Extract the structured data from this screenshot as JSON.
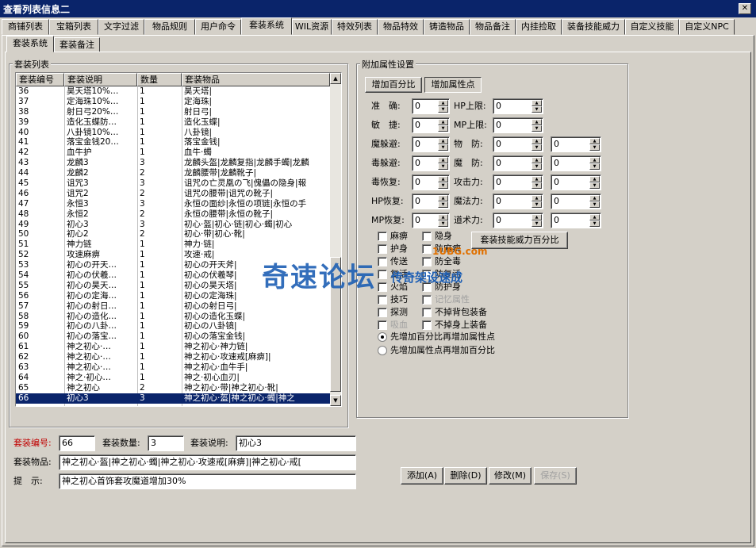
{
  "window": {
    "title": "查看列表信息二",
    "close_label": "✕"
  },
  "tabs": [
    "商铺列表",
    "宝箱列表",
    "文字过滤",
    "物品规则",
    "用户命令",
    "套装系统",
    "WIL资源",
    "特效列表",
    "物品特效",
    "铸造物品",
    "物品备注",
    "内挂捡取",
    "装备技能威力",
    "自定义技能",
    "自定义NPC"
  ],
  "active_tab": "套装系统",
  "subtabs": [
    "套装系统",
    "套装备注"
  ],
  "list": {
    "group_title": "套装列表",
    "columns": [
      "套装编号",
      "套装说明",
      "数量",
      "套装物品"
    ],
    "rows": [
      [
        "36",
        "昊天塔10%…",
        "1",
        "昊天塔|"
      ],
      [
        "37",
        "定海珠10%…",
        "1",
        "定海珠|"
      ],
      [
        "38",
        "射日弓20%…",
        "1",
        "射日弓|"
      ],
      [
        "39",
        "造化玉蝶防…",
        "1",
        "造化玉蝶|"
      ],
      [
        "40",
        "八卦镜10%…",
        "1",
        "八卦镜|"
      ],
      [
        "41",
        "落宝金钱20…",
        "1",
        "落宝金钱|"
      ],
      [
        "42",
        "血牛护",
        "1",
        "血牛·蠋"
      ],
      [
        "43",
        "龙麟3",
        "3",
        "龙麟头盔|龙麟复指|龙麟手蠋|龙麟"
      ],
      [
        "44",
        "龙麟2",
        "2",
        "龙麟腰带|龙麟靴子|"
      ],
      [
        "45",
        "诅咒3",
        "3",
        "诅咒の亡灵凰の飞|傀儡の隐身|報"
      ],
      [
        "46",
        "诅咒2",
        "2",
        "诅咒の腰带|诅咒の靴子|"
      ],
      [
        "47",
        "永恒3",
        "3",
        "永恒の面纱|永恒の项链|永恒の手"
      ],
      [
        "48",
        "永恒2",
        "2",
        "永恒の腰带|永恒の靴子|"
      ],
      [
        "49",
        "初心3",
        "3",
        "初心·盔|初心·链|初心·蠋|初心"
      ],
      [
        "50",
        "初心2",
        "2",
        "初心·带|初心·靴|"
      ],
      [
        "51",
        "神力链",
        "1",
        "神力·链|"
      ],
      [
        "52",
        "攻速麻痹",
        "1",
        "攻速·戒|"
      ],
      [
        "53",
        "初心の开天…",
        "1",
        "初心の开天斧|"
      ],
      [
        "54",
        "初心の伏羲…",
        "1",
        "初心の伏羲琴|"
      ],
      [
        "55",
        "初心の昊天…",
        "1",
        "初心の昊天塔|"
      ],
      [
        "56",
        "初心の定海…",
        "1",
        "初心の定海珠|"
      ],
      [
        "57",
        "初心の射日…",
        "1",
        "初心の射日弓|"
      ],
      [
        "58",
        "初心の造化…",
        "1",
        "初心の造化玉蝶|"
      ],
      [
        "59",
        "初心の八卦…",
        "1",
        "初心の八卦镜|"
      ],
      [
        "60",
        "初心の落宝…",
        "1",
        "初心の落宝金钱|"
      ],
      [
        "61",
        "神之初心·…",
        "1",
        "神之初心·神力链|"
      ],
      [
        "62",
        "神之初心·…",
        "1",
        "神之初心·攻速戒[麻痹]|"
      ],
      [
        "63",
        "神之初心·…",
        "1",
        "神之初心·血牛手|"
      ],
      [
        "64",
        "神之·初心…",
        "1",
        "神之·初心血刃|"
      ],
      [
        "65",
        "神之初心",
        "2",
        "神之初心·带|神之初心·靴|"
      ],
      [
        "66",
        "初心3",
        "3",
        "神之初心·盔|神之初心·蠋|神之"
      ]
    ],
    "selected_row": "66"
  },
  "attr": {
    "group_title": "附加属性设置",
    "btn_percent": "增加百分比",
    "btn_points": "增加属性点",
    "fields_left": [
      {
        "label": "准　确:",
        "value": "0"
      },
      {
        "label": "敏　捷:",
        "value": "0"
      },
      {
        "label": "魔躲避:",
        "value": "0"
      },
      {
        "label": "毒躲避:",
        "value": "0"
      },
      {
        "label": "毒恢复:",
        "value": "0"
      },
      {
        "label": "HP恢复:",
        "value": "0"
      },
      {
        "label": "MP恢复:",
        "value": "0"
      }
    ],
    "fields_right": [
      {
        "label": "HP上限:",
        "value": "0",
        "value2": null
      },
      {
        "label": "MP上限:",
        "value": "0",
        "value2": null
      },
      {
        "label": "物　防:",
        "value": "0",
        "value2": "0"
      },
      {
        "label": "魔　防:",
        "value": "0",
        "value2": "0"
      },
      {
        "label": "攻击力:",
        "value": "0",
        "value2": "0"
      },
      {
        "label": "魔法力:",
        "value": "0",
        "value2": "0"
      },
      {
        "label": "道术力:",
        "value": "0",
        "value2": "0"
      }
    ],
    "checks_col1": [
      "麻痹",
      "护身",
      "传送",
      "复活",
      "火焰",
      "技巧",
      "探测",
      "吸血"
    ],
    "checks_col2": [
      "隐身",
      "防麻痹",
      "防全毒",
      "防复活",
      "防护身",
      "记忆属性",
      "不掉背包装备",
      "不掉身上装备"
    ],
    "skill_btn": "套装技能威力百分比",
    "radio1": "先增加百分比再增加属性点",
    "radio2": "先增加属性点再增加百分比"
  },
  "form": {
    "id_label": "套装编号:",
    "id_value": "66",
    "count_label": "套装数量:",
    "count_value": "3",
    "desc_label": "套装说明:",
    "desc_value": "初心3",
    "items_label": "套装物品:",
    "items_value": "神之初心·盔|神之初心·蠋|神之初心·攻速戒[麻痹]|神之初心·戒[",
    "hint_label": "提　示:",
    "hint_value": "神之初心首饰套攻魔道增加30%"
  },
  "actions": {
    "add": "添加(A)",
    "delete": "删除(D)",
    "edit": "修改(M)",
    "save": "保存(S)"
  },
  "watermark": {
    "main": "奇速论坛",
    "sub": "传奇架设速成",
    "site": "1UBG.com"
  },
  "colors": {
    "titlebar": "#0a246a",
    "selection": "#0a246a",
    "red_label": "#c00000",
    "watermark": "#1e5fb4"
  }
}
